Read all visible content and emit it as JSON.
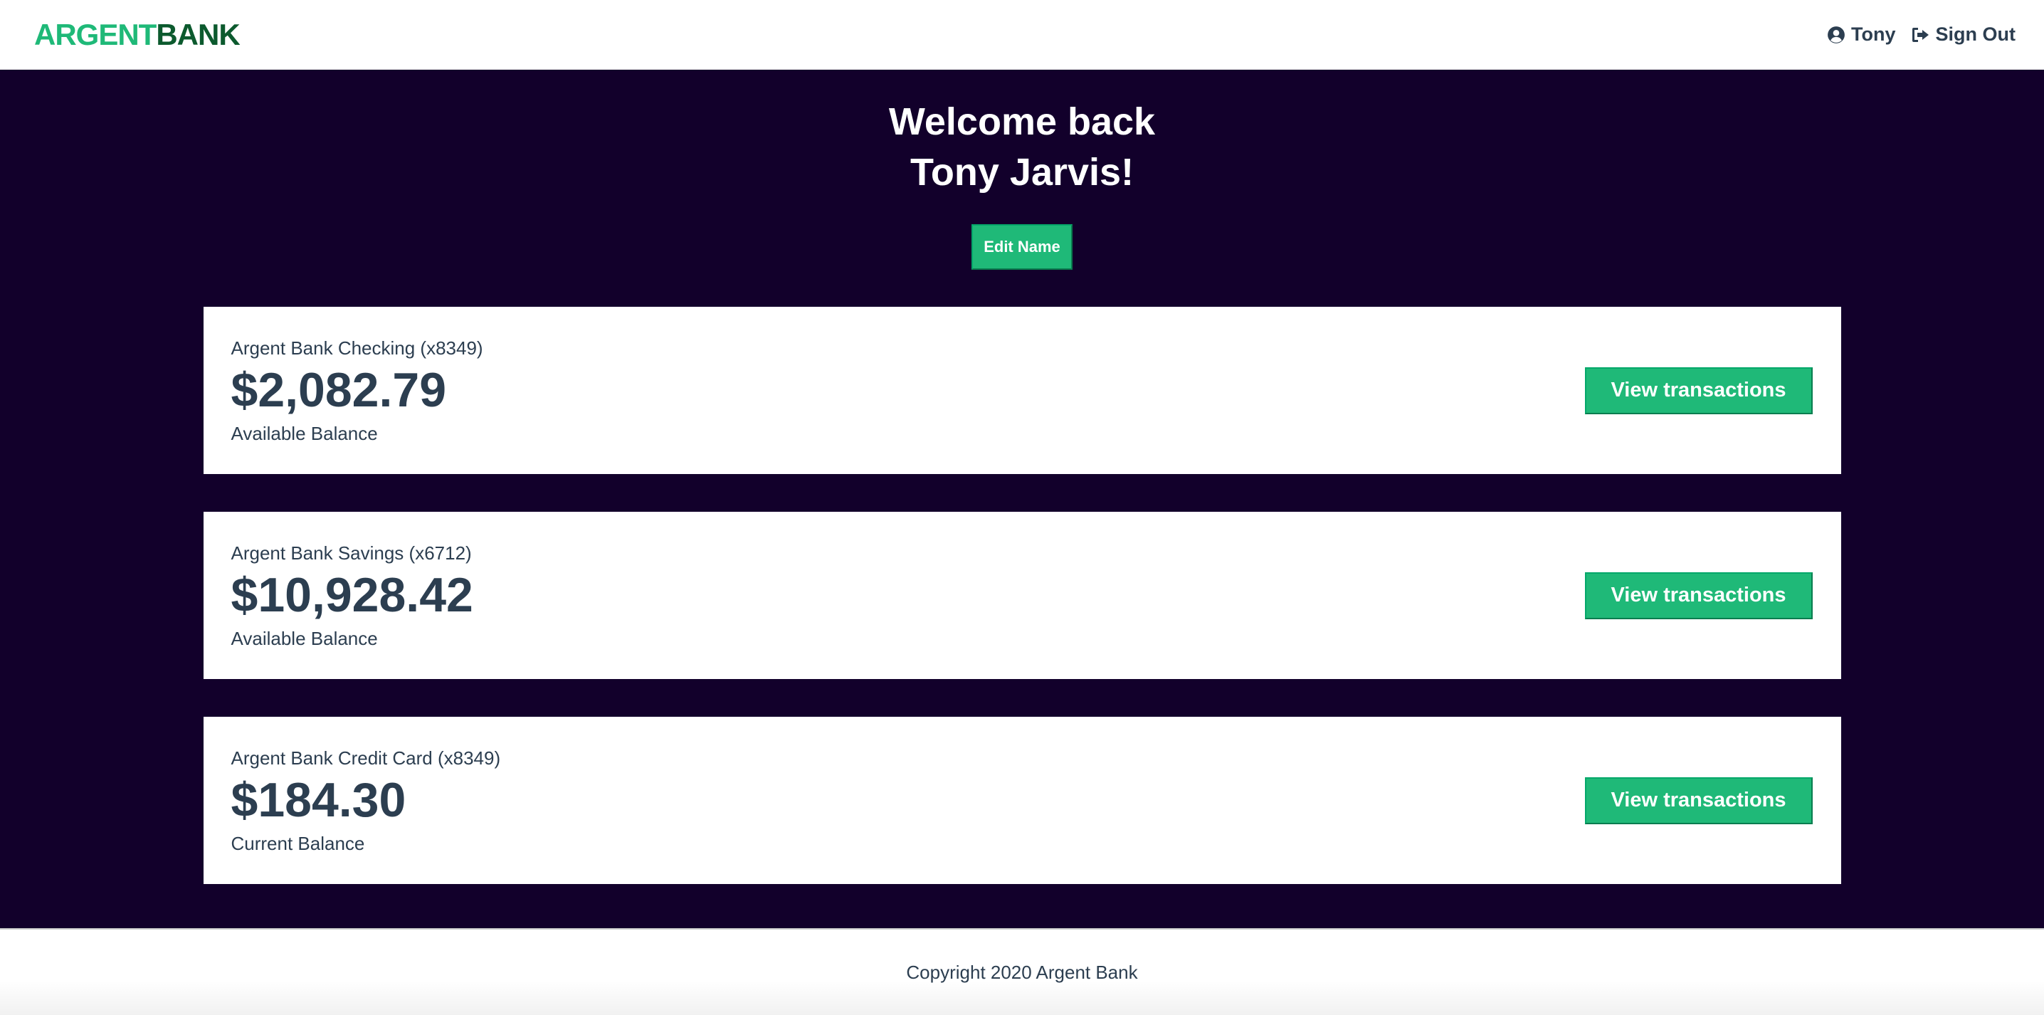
{
  "nav": {
    "logo_part1": "ARGENT",
    "logo_part2": "BANK",
    "user_name": "Tony",
    "sign_out": "Sign Out",
    "user_icon": "user-circle-icon",
    "sign_out_icon": "sign-out-icon"
  },
  "header": {
    "line1": "Welcome back",
    "line2": "Tony Jarvis!",
    "edit_button": "Edit Name"
  },
  "accounts": [
    {
      "title": "Argent Bank Checking (x8349)",
      "amount": "$2,082.79",
      "description": "Available Balance",
      "button": "View transactions"
    },
    {
      "title": "Argent Bank Savings (x6712)",
      "amount": "$10,928.42",
      "description": "Available Balance",
      "button": "View transactions"
    },
    {
      "title": "Argent Bank Credit Card (x8349)",
      "amount": "$184.30",
      "description": "Current Balance",
      "button": "View transactions"
    }
  ],
  "footer": {
    "copyright": "Copyright 2020 Argent Bank"
  },
  "colors": {
    "brand_green": "#1fb978",
    "brand_dark_green": "#0c5a2e",
    "main_background": "#12002b",
    "text": "#2c3e50"
  }
}
